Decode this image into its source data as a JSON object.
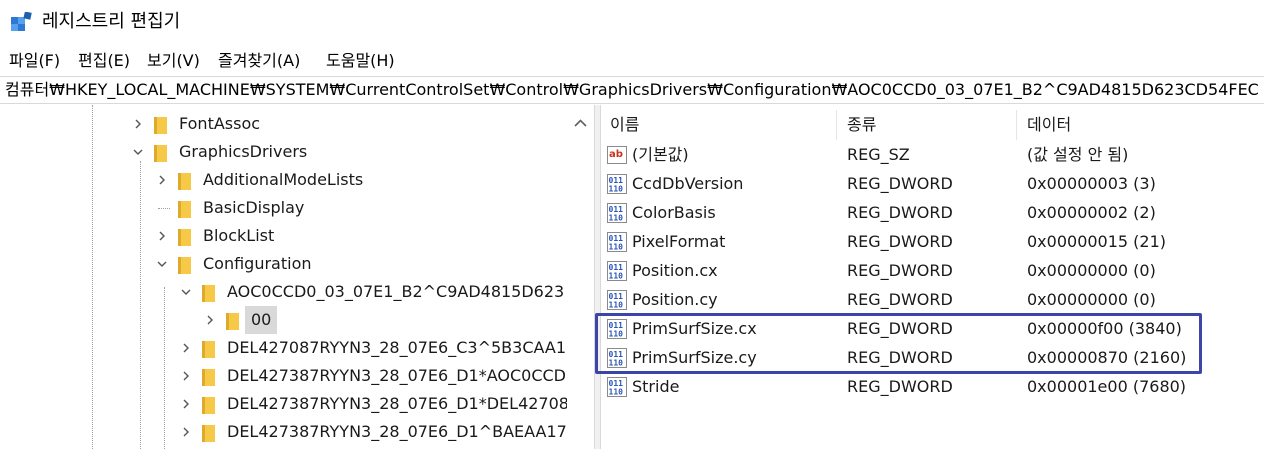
{
  "window": {
    "title": "레지스트리 편집기"
  },
  "menu": [
    {
      "label": "파일(F)"
    },
    {
      "label": "편집(E)"
    },
    {
      "label": "보기(V)"
    },
    {
      "label": "즐겨찾기(A)"
    },
    {
      "label": "도움말(H)"
    }
  ],
  "address": {
    "path": "컴퓨터₩HKEY_LOCAL_MACHINE₩SYSTEM₩CurrentControlSet₩Control₩GraphicsDrivers₩Configuration₩AOC0CCD0_03_07E1_B2^C9AD4815D623CD54FEC"
  },
  "tree": [
    {
      "label": "FontAssoc",
      "expander": "collapsed"
    },
    {
      "label": "GraphicsDrivers",
      "expander": "expanded"
    },
    {
      "label": "AdditionalModeLists",
      "expander": "collapsed"
    },
    {
      "label": "BasicDisplay",
      "expander": "none"
    },
    {
      "label": "BlockList",
      "expander": "collapsed"
    },
    {
      "label": "Configuration",
      "expander": "expanded"
    },
    {
      "label": "AOC0CCD0_03_07E1_B2^C9AD4815D623",
      "expander": "expanded"
    },
    {
      "label": "00",
      "expander": "collapsed",
      "selected": true
    },
    {
      "label": "DEL427087RYYN3_28_07E6_C3^5B3CAA1",
      "expander": "collapsed"
    },
    {
      "label": "DEL427387RYYN3_28_07E6_D1*AOC0CCD",
      "expander": "collapsed"
    },
    {
      "label": "DEL427387RYYN3_28_07E6_D1*DEL42708",
      "expander": "collapsed"
    },
    {
      "label": "DEL427387RYYN3_28_07E6_D1^BAEAA17",
      "expander": "collapsed"
    }
  ],
  "list": {
    "columns": [
      "이름",
      "종류",
      "데이터"
    ],
    "rows": [
      {
        "name": "(기본값)",
        "type": "REG_SZ",
        "data": "(값 설정 안 됨)",
        "icon": "string-value-icon"
      },
      {
        "name": "CcdDbVersion",
        "type": "REG_DWORD",
        "data": "0x00000003 (3)",
        "icon": "binary-value-icon"
      },
      {
        "name": "ColorBasis",
        "type": "REG_DWORD",
        "data": "0x00000002 (2)",
        "icon": "binary-value-icon"
      },
      {
        "name": "PixelFormat",
        "type": "REG_DWORD",
        "data": "0x00000015 (21)",
        "icon": "binary-value-icon"
      },
      {
        "name": "Position.cx",
        "type": "REG_DWORD",
        "data": "0x00000000 (0)",
        "icon": "binary-value-icon"
      },
      {
        "name": "Position.cy",
        "type": "REG_DWORD",
        "data": "0x00000000 (0)",
        "icon": "binary-value-icon"
      },
      {
        "name": "PrimSurfSize.cx",
        "type": "REG_DWORD",
        "data": "0x00000f00 (3840)",
        "icon": "binary-value-icon"
      },
      {
        "name": "PrimSurfSize.cy",
        "type": "REG_DWORD",
        "data": "0x00000870 (2160)",
        "icon": "binary-value-icon"
      },
      {
        "name": "Stride",
        "type": "REG_DWORD",
        "data": "0x00001e00 (7680)",
        "icon": "binary-value-icon"
      }
    ]
  },
  "colors": {
    "highlight_box": "#3c46a8",
    "folder": "#f7c948",
    "selection": "#d9d9d9"
  }
}
